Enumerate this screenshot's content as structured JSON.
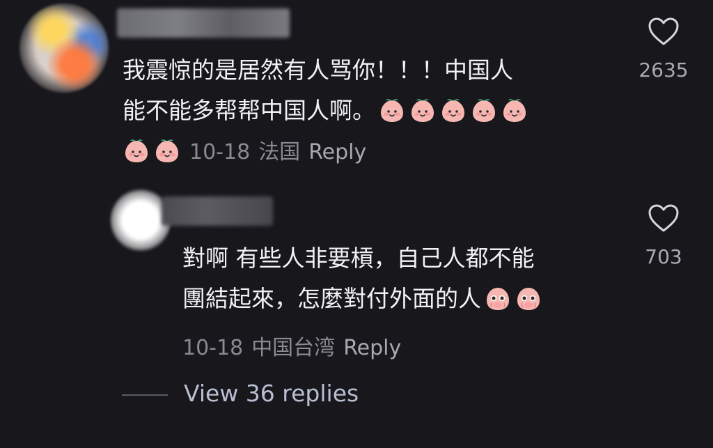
{
  "comments": [
    {
      "text_line1": "我震惊的是居然有人骂你！！！中国人",
      "text_line2": "能不能多帮帮中国人啊。",
      "date": "10-18",
      "location": "法国",
      "reply_label": "Reply",
      "likes": "2635",
      "emoji": "peach-face",
      "emoji_count": 7
    },
    {
      "text_line1": "對啊 有些人非要槓，自己人都不能",
      "text_line2": "團結起來，怎麼對付外面的人",
      "date": "10-18",
      "location": "中国台湾",
      "reply_label": "Reply",
      "likes": "703",
      "emoji": "crying-peach-face",
      "emoji_count": 2
    }
  ],
  "view_replies_label": "View 36 replies",
  "colors": {
    "background": "#17171c",
    "text": "#f2f2f4",
    "meta": "#8a8a94",
    "link": "#b9bfd2"
  },
  "icons": {
    "like": "heart-outline-icon"
  }
}
